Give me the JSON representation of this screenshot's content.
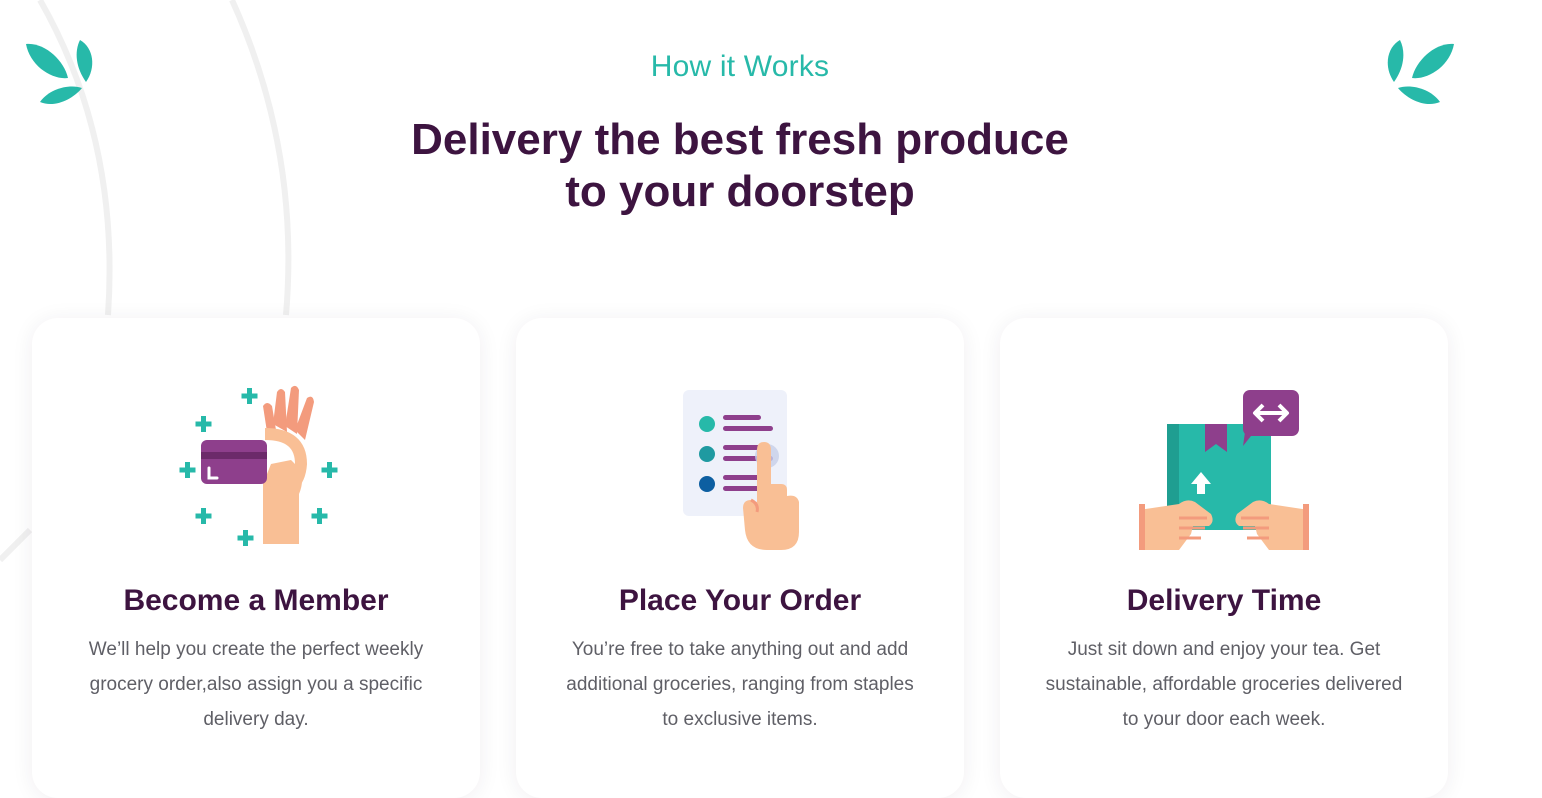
{
  "section": {
    "eyebrow": "How it Works",
    "headline_line1": "Delivery the best fresh produce",
    "headline_line2": "to your doorstep"
  },
  "cards": [
    {
      "icon": "card-in-hand-icon",
      "title": "Become a Member",
      "text": "We’ll help you create the perfect weekly grocery order,also assign you a specific delivery day."
    },
    {
      "icon": "checklist-tap-icon",
      "title": "Place Your Order",
      "text": "You’re free to take anything out and add additional groceries, ranging from staples to exclusive items."
    },
    {
      "icon": "box-delivery-icon",
      "title": "Delivery Time",
      "text": "Just sit down and enjoy your tea. Get sustainable, affordable groceries delivered to your door each week."
    }
  ],
  "colors": {
    "accent": "#27b9a9",
    "heading": "#3d1440",
    "body_text": "#5f5f66",
    "purple": "#8e3f8c",
    "skin": "#f9bf95"
  }
}
